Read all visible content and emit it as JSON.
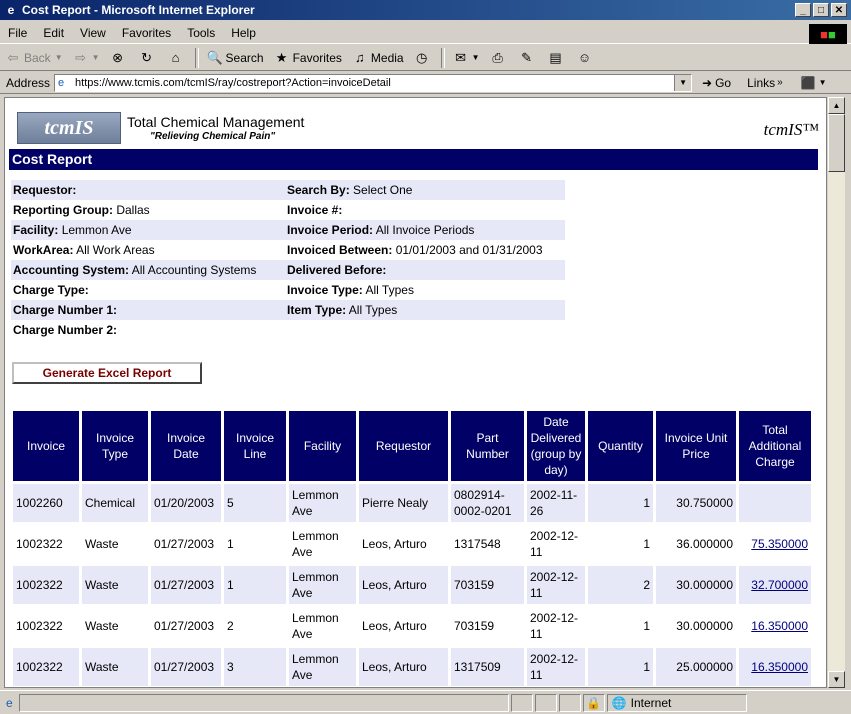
{
  "window": {
    "title": "Cost Report - Microsoft Internet Explorer"
  },
  "menu": {
    "items": [
      "File",
      "Edit",
      "View",
      "Favorites",
      "Tools",
      "Help"
    ]
  },
  "toolbar": {
    "back": "Back",
    "search": "Search",
    "favorites": "Favorites",
    "media": "Media"
  },
  "address": {
    "label": "Address",
    "url": "https://www.tcmis.com/tcmIS/ray/costreport?Action=invoiceDetail",
    "go": "Go",
    "links": "Links"
  },
  "header": {
    "logo": "tcmIS",
    "title": "Total Chemical Management",
    "subtitle": "\"Relieving Chemical Pain\"",
    "right_logo": "tcmIS™"
  },
  "report": {
    "title": "Cost Report"
  },
  "criteria": [
    {
      "l1": "Requestor:",
      "v1": "",
      "l2": "Search By:",
      "v2": "Select One"
    },
    {
      "l1": "Reporting Group:",
      "v1": "Dallas",
      "l2": "Invoice #:",
      "v2": ""
    },
    {
      "l1": "Facility:",
      "v1": "Lemmon Ave",
      "l2": "Invoice Period:",
      "v2": "All Invoice Periods"
    },
    {
      "l1": "WorkArea:",
      "v1": "All Work Areas",
      "l2": "Invoiced Between:",
      "v2": "01/01/2003 and 01/31/2003"
    },
    {
      "l1": "Accounting System:",
      "v1": "All Accounting Systems",
      "l2": "Delivered Before:",
      "v2": ""
    },
    {
      "l1": "Charge Type:",
      "v1": "",
      "l2": "Invoice Type:",
      "v2": "All Types"
    },
    {
      "l1": "Charge Number 1:",
      "v1": "",
      "l2": "Item Type:",
      "v2": "All Types"
    },
    {
      "l1": "Charge Number 2:",
      "v1": "",
      "l2": "",
      "v2": ""
    }
  ],
  "excel_button": "Generate Excel Report",
  "table": {
    "headers": [
      "Invoice",
      "Invoice Type",
      "Invoice Date",
      "Invoice Line",
      "Facility",
      "Requestor",
      "Part Number",
      "Date Delivered (group by day)",
      "Quantity",
      "Invoice Unit Price",
      "Total Additional Charge"
    ],
    "rows": [
      {
        "invoice": "1002260",
        "type": "Chemical",
        "date": "01/20/2003",
        "line": "5",
        "facility": "Lemmon Ave",
        "requestor": "Pierre Nealy",
        "part": "0802914-0002-0201",
        "delivered": "2002-11-26",
        "qty": "1",
        "price": "30.750000",
        "charge": ""
      },
      {
        "invoice": "1002322",
        "type": "Waste",
        "date": "01/27/2003",
        "line": "1",
        "facility": "Lemmon Ave",
        "requestor": "Leos, Arturo",
        "part": "1317548",
        "delivered": "2002-12-11",
        "qty": "1",
        "price": "36.000000",
        "charge": "75.350000"
      },
      {
        "invoice": "1002322",
        "type": "Waste",
        "date": "01/27/2003",
        "line": "1",
        "facility": "Lemmon Ave",
        "requestor": "Leos, Arturo",
        "part": "703159",
        "delivered": "2002-12-11",
        "qty": "2",
        "price": "30.000000",
        "charge": "32.700000"
      },
      {
        "invoice": "1002322",
        "type": "Waste",
        "date": "01/27/2003",
        "line": "2",
        "facility": "Lemmon Ave",
        "requestor": "Leos, Arturo",
        "part": "703159",
        "delivered": "2002-12-11",
        "qty": "1",
        "price": "30.000000",
        "charge": "16.350000"
      },
      {
        "invoice": "1002322",
        "type": "Waste",
        "date": "01/27/2003",
        "line": "3",
        "facility": "Lemmon Ave",
        "requestor": "Leos, Arturo",
        "part": "1317509",
        "delivered": "2002-12-11",
        "qty": "1",
        "price": "25.000000",
        "charge": "16.350000"
      }
    ]
  },
  "status": {
    "zone": "Internet"
  }
}
